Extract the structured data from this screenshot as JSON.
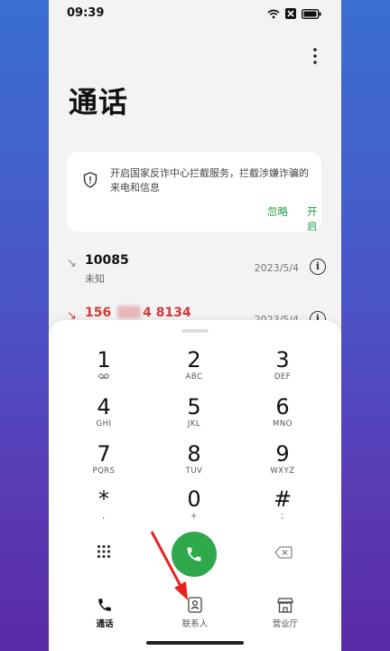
{
  "status": {
    "time": "09:39"
  },
  "header": {
    "title": "通话"
  },
  "notice": {
    "message": "开启国家反诈中心拦截服务，拦截涉嫌诈骗的来电和信息",
    "ignore_label": "忽略",
    "enable_label": "开启"
  },
  "calls": [
    {
      "number": "10085",
      "sub": "未知",
      "date": "2023/5/4",
      "type": "incoming"
    },
    {
      "number_prefix": "156",
      "number_suffix": "4 8134",
      "date": "2023/5/4",
      "type": "missed"
    }
  ],
  "dialpad": {
    "keys": [
      {
        "digit": "1",
        "letters": ""
      },
      {
        "digit": "2",
        "letters": "ABC"
      },
      {
        "digit": "3",
        "letters": "DEF"
      },
      {
        "digit": "4",
        "letters": "GHI"
      },
      {
        "digit": "5",
        "letters": "JKL"
      },
      {
        "digit": "6",
        "letters": "MNO"
      },
      {
        "digit": "7",
        "letters": "PQRS"
      },
      {
        "digit": "8",
        "letters": "TUV"
      },
      {
        "digit": "9",
        "letters": "WXYZ"
      },
      {
        "digit": "*",
        "letters": ","
      },
      {
        "digit": "0",
        "letters": "+"
      },
      {
        "digit": "#",
        "letters": ";"
      }
    ]
  },
  "tabs": [
    {
      "label": "通话",
      "icon": "phone-icon",
      "active": true
    },
    {
      "label": "联系人",
      "icon": "contacts-icon",
      "active": false
    },
    {
      "label": "营业厅",
      "icon": "store-icon",
      "active": false
    }
  ],
  "colors": {
    "accent": "#2fa84b",
    "missed": "#d33a3a",
    "annotation_arrow": "#e8231f"
  }
}
